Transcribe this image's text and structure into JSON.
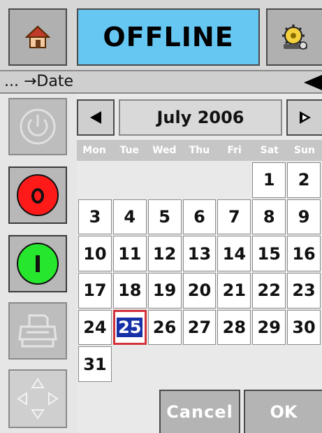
{
  "header": {
    "status": "OFFLINE",
    "home_icon": "home-icon",
    "settings_icon": "gear-settings-icon"
  },
  "breadcrumb": {
    "text": "... →Date"
  },
  "side_buttons": [
    {
      "name": "power-icon",
      "state": "disabled"
    },
    {
      "name": "stop-icon",
      "label": "O",
      "color": "#ff1a1a"
    },
    {
      "name": "start-icon",
      "label": "I",
      "color": "#27e62e"
    },
    {
      "name": "printer-icon",
      "state": "disabled"
    },
    {
      "name": "navigation-arrows-icon"
    }
  ],
  "calendar": {
    "month_label": "July 2006",
    "weekdays": [
      "Mon",
      "Tue",
      "Wed",
      "Thu",
      "Fri",
      "Sat",
      "Sun"
    ],
    "weeks": [
      [
        "",
        "",
        "",
        "",
        "",
        "1",
        "2"
      ],
      [
        "3",
        "4",
        "5",
        "6",
        "7",
        "8",
        "9"
      ],
      [
        "10",
        "11",
        "12",
        "13",
        "14",
        "15",
        "16"
      ],
      [
        "17",
        "18",
        "19",
        "20",
        "21",
        "22",
        "23"
      ],
      [
        "24",
        "25",
        "26",
        "27",
        "28",
        "29",
        "30"
      ],
      [
        "31",
        "",
        "",
        "",
        "",
        "",
        ""
      ]
    ],
    "selected_day": "25",
    "selected_bg": "#1630a8",
    "selected_border": "#d4323b"
  },
  "footer": {
    "cancel_label": "Cancel",
    "ok_label": "OK"
  },
  "colors": {
    "status_bg": "#66c7f3",
    "button_bg": "#b4b4b4"
  }
}
